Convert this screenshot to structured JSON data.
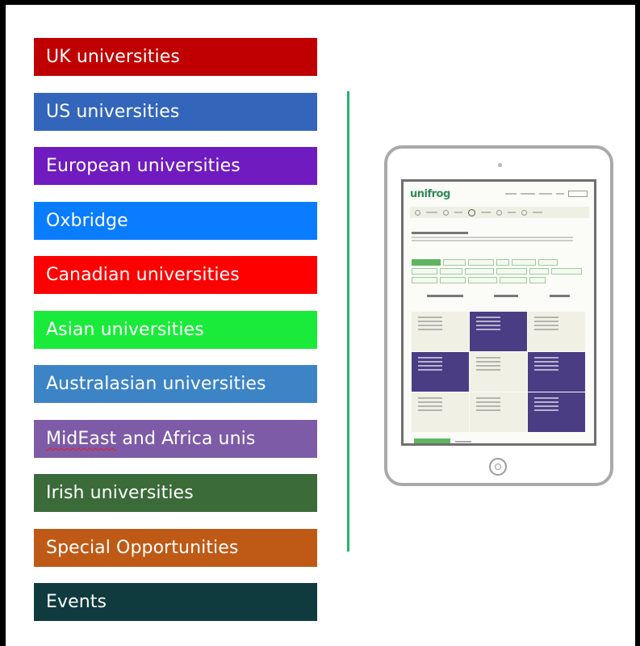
{
  "menu": {
    "items": [
      {
        "label": "UK universities",
        "color": "#c00000"
      },
      {
        "label": "US universities",
        "color": "#3366bb"
      },
      {
        "label": "European universities",
        "color": "#6f1bbf"
      },
      {
        "label": "Oxbridge",
        "color": "#0a7cff"
      },
      {
        "label": "Canadian universities",
        "color": "#ff0000"
      },
      {
        "label": "Asian universities",
        "color": "#1aeb3a"
      },
      {
        "label": "Australasian universities",
        "color": "#3d84c6"
      },
      {
        "label": "MidEast",
        "label_rest": " and Africa unis",
        "color": "#7d5ba6"
      },
      {
        "label": "Irish universities",
        "color": "#3a6b39"
      },
      {
        "label": "Special Opportunities",
        "color": "#bf5a16"
      },
      {
        "label": "Events",
        "color": "#0f3b3f"
      }
    ]
  },
  "divider_color": "#22b573",
  "tablet": {
    "app_logo": "unifrog",
    "icons": [
      "camera-icon",
      "home-button-icon"
    ]
  }
}
